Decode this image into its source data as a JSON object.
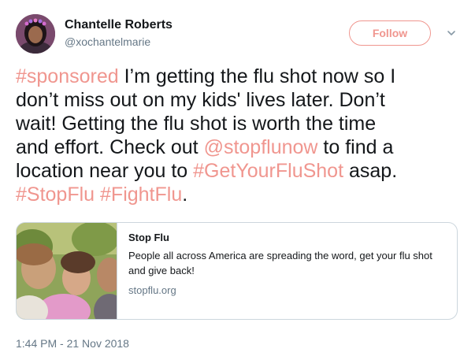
{
  "author": {
    "display_name": "Chantelle Roberts",
    "handle": "@xochantelmarie",
    "avatar": "avatar-photo"
  },
  "follow_button": {
    "label": "Follow"
  },
  "menu": {
    "icon": "chevron-down-icon"
  },
  "tweet": {
    "lines": [
      [
        {
          "text": "#sponsored",
          "kind": "hashtag"
        },
        {
          "text": " I’m getting the flu shot now so I",
          "kind": "text"
        }
      ],
      [
        {
          "text": "don’t miss out on my kids' lives later. Don’t",
          "kind": "text"
        }
      ],
      [
        {
          "text": "wait! Getting the flu shot is worth the time",
          "kind": "text"
        }
      ],
      [
        {
          "text": "and effort. Check out ",
          "kind": "text"
        },
        {
          "text": "@stopflunow",
          "kind": "mention"
        },
        {
          "text": " to find a",
          "kind": "text"
        }
      ],
      [
        {
          "text": "location near you to ",
          "kind": "text"
        },
        {
          "text": "#GetYourFluShot",
          "kind": "hashtag"
        },
        {
          "text": " asap.",
          "kind": "text"
        }
      ],
      [
        {
          "text": "#StopFlu",
          "kind": "hashtag"
        },
        {
          "text": " ",
          "kind": "text"
        },
        {
          "text": "#FightFlu",
          "kind": "hashtag"
        },
        {
          "text": ".",
          "kind": "text"
        }
      ]
    ]
  },
  "card": {
    "title": "Stop Flu",
    "description": "People all across America are spreading the word, get your flu shot and give back!",
    "domain": "stopflu.org",
    "image": "family-photo"
  },
  "timestamp": "1:44 PM - 21 Nov 2018",
  "colors": {
    "accent": "#f0968f",
    "text": "#14171a",
    "muted": "#657786",
    "border": "#ccd6dd"
  }
}
